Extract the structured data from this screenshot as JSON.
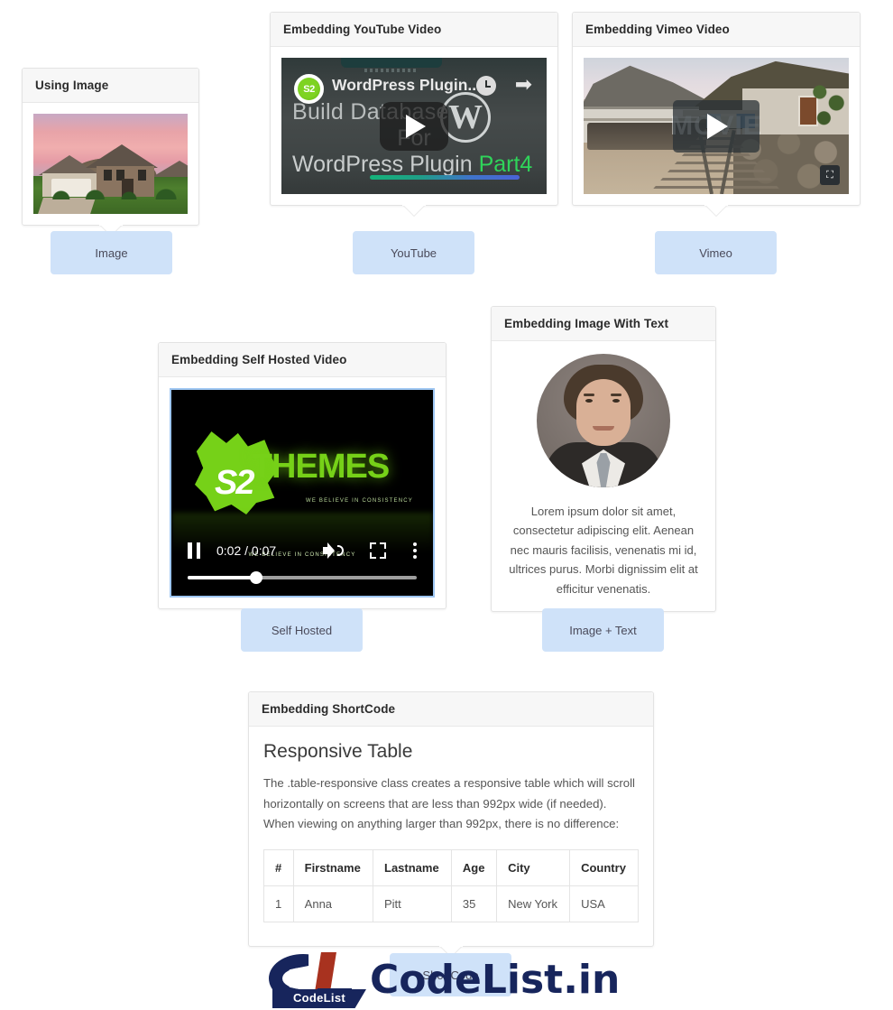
{
  "page": {
    "background": "#ffffff",
    "accent_pill": "#cfe2f9",
    "brand_navy": "#17255c",
    "brand_red": "#a8321f"
  },
  "cards": {
    "image": {
      "title": "Using Image",
      "pill": "Image",
      "photo_alt": "suburban two-story house at sunset with pink sky and green lawn"
    },
    "youtube": {
      "title": "Embedding YouTube Video",
      "pill": "YouTube",
      "thumb": {
        "channel_badge": "S2",
        "video_title": "WordPress Plugin...",
        "line1": "Build Database",
        "line2": "For",
        "line3": "WordPress Plugin",
        "line3_highlight": "Part4",
        "wordpress_mark": "W",
        "clock_icon": "clock-icon",
        "share_icon": "share-icon",
        "play_icon": "play-icon"
      }
    },
    "vimeo": {
      "title": "Embedding Vimeo Video",
      "pill": "Vimeo",
      "thumb": {
        "overlay_text": "MOVIE",
        "play_icon": "play-icon",
        "fullscreen_icon": "fullscreen-icon",
        "scene_alt": "railway track between mountain village buildings"
      }
    },
    "self_hosted": {
      "title": "Embedding Self Hosted Video",
      "pill": "Self Hosted",
      "player": {
        "logo_main": "THEMES",
        "logo_badge": "S2",
        "tagline": "WE BELIEVE IN CONSISTENCY",
        "tagline_small": "WE BELIEVE IN CONSISTENCY",
        "time": "0:02 / 0:07",
        "current_time": "0:02",
        "duration": "0:07",
        "progress_percent": 30,
        "pause_icon": "pause-icon",
        "volume_icon": "volume-icon",
        "fullscreen_icon": "fullscreen-icon",
        "more_icon": "more-options-icon"
      }
    },
    "image_text": {
      "title": "Embedding Image With Text",
      "pill": "Image + Text",
      "avatar_alt": "portrait of a man in a dark suit with a grey tie",
      "paragraph": "Lorem ipsum dolor sit amet, consectetur adipiscing elit. Aenean nec mauris facilisis, venenatis mi id, ultrices purus. Morbi dignissim elit at efficitur venenatis."
    },
    "shortcode": {
      "title": "Embedding ShortCode",
      "pill": "ShortCode",
      "heading": "Responsive Table",
      "paragraph": "The .table-responsive class creates a responsive table which will scroll horizontally on screens that are less than 992px wide (if needed). When viewing on anything larger than 992px, there is no difference:",
      "table": {
        "headers": [
          "#",
          "Firstname",
          "Lastname",
          "Age",
          "City",
          "Country"
        ],
        "rows": [
          [
            "1",
            "Anna",
            "Pitt",
            "35",
            "New York",
            "USA"
          ]
        ]
      }
    }
  },
  "watermark": {
    "banner": "CodeList",
    "text": "CodeList.in"
  }
}
